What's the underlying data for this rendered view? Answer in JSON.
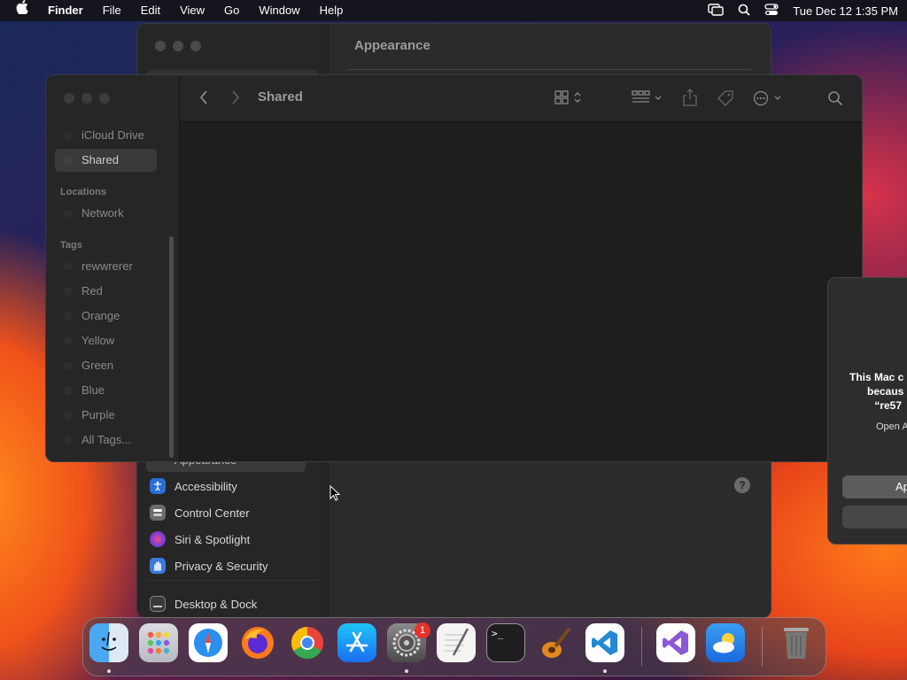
{
  "menubar": {
    "apple": "",
    "items": [
      "Finder",
      "File",
      "Edit",
      "View",
      "Go",
      "Window",
      "Help"
    ],
    "clock": "Tue Dec 12  1:35 PM"
  },
  "settings": {
    "title": "Appearance",
    "partial_item": "Appearance",
    "items": [
      {
        "label": "Accessibility",
        "icon": "accessibility-icon",
        "color": "#2a6fd6"
      },
      {
        "label": "Control Center",
        "icon": "control-center-icon",
        "color": "#6b6b6b"
      },
      {
        "label": "Siri & Spotlight",
        "icon": "siri-icon",
        "color": "#b04ad6"
      },
      {
        "label": "Privacy & Security",
        "icon": "hand-icon",
        "color": "#3a7be0"
      },
      {
        "label": "Desktop & Dock",
        "icon": "desktop-dock-icon",
        "color": "#3a3a3a"
      }
    ],
    "help": "?"
  },
  "finder": {
    "title": "Shared",
    "favorites": [
      "iCloud Drive",
      "Shared"
    ],
    "locations_header": "Locations",
    "locations": [
      "Network"
    ],
    "tags_header": "Tags",
    "tags": [
      "rewwrerer",
      "Red",
      "Orange",
      "Yellow",
      "Green",
      "Blue",
      "Purple",
      "All Tags..."
    ]
  },
  "alert": {
    "line1": "This Mac c",
    "line2": "becaus",
    "line3": "“re57",
    "sub": "Open A",
    "button1": "Ap"
  },
  "dock": {
    "apps": [
      "Finder",
      "Launchpad",
      "Safari",
      "Firefox",
      "Chrome",
      "App Store",
      "System Settings",
      "TextEdit",
      "Terminal",
      "GarageBand",
      "Visual Studio Code",
      "Visual Studio",
      "Weather",
      "Trash"
    ],
    "settings_badge": "1"
  }
}
